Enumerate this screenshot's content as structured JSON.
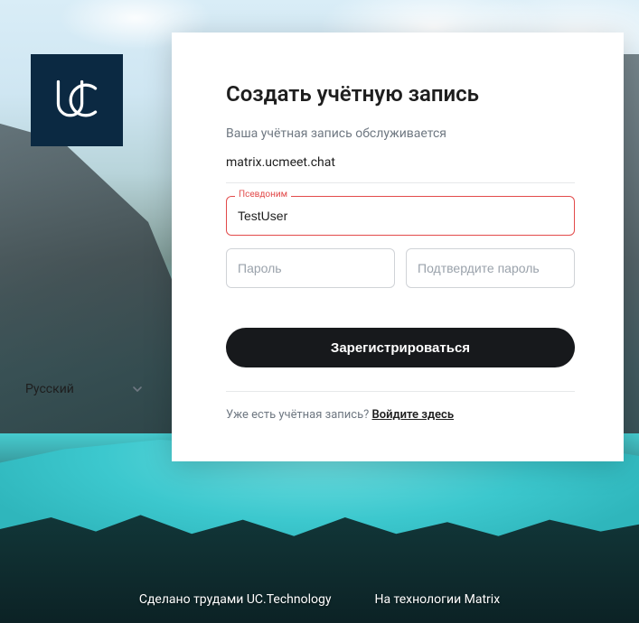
{
  "logo_text": "UC",
  "card": {
    "title": "Создать учётную запись",
    "subtitle": "Ваша учётная запись обслуживается",
    "server": "matrix.ucmeet.chat",
    "username_label": "Псевдоним",
    "username_value": "TestUser",
    "password_placeholder": "Пароль",
    "confirm_placeholder": "Подтвердите пароль",
    "register_label": "Зарегистрироваться",
    "login_prompt": "Уже есть учётная запись? ",
    "login_link": "Войдите здесь"
  },
  "language": {
    "selected": "Русский"
  },
  "footer": {
    "left": "Сделано трудами UC.Technology",
    "right": "На технологии Matrix"
  },
  "colors": {
    "logo_bg": "#0b2942",
    "error": "#e24a4a",
    "button_bg": "#17191c"
  }
}
